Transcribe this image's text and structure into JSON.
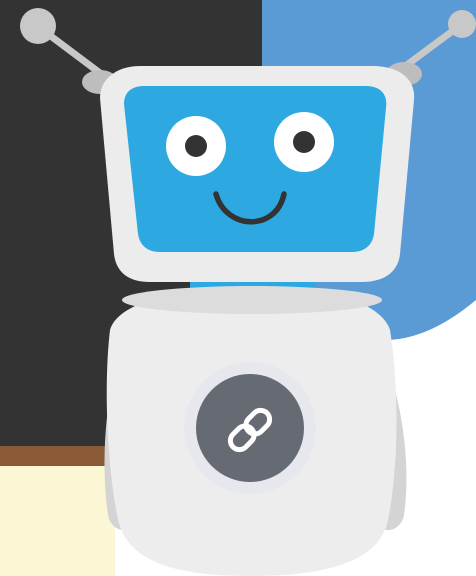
{
  "illustration": {
    "subject": "robot-mascot",
    "center_icon": "link-icon",
    "colors": {
      "dark_panel": "#333333",
      "blue_panel": "#5b9bd5",
      "brown_stripe": "#8a5a36",
      "cream_floor": "#fbf7d4",
      "head_frame": "#ececec",
      "screen_blue": "#2ea8e0",
      "neck_blue": "#2ea8e0",
      "body": "#ededed",
      "arm": "#d4d4d4",
      "badge_ring": "#e6e8ee",
      "badge": "#666a72",
      "eye_white": "#ffffff",
      "pupil": "#333333",
      "smile": "#333333",
      "antenna": "#c8c8c8"
    }
  }
}
